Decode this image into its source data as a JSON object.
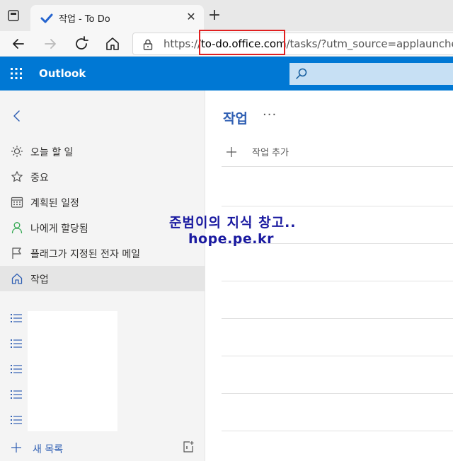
{
  "browser": {
    "tab_title": "작업 - To Do",
    "url_prefix": "https://",
    "url_domain": "to-do.office.com",
    "url_suffix": "/tasks/?utm_source=applauncher"
  },
  "app": {
    "name": "Outlook",
    "accent_color": "#0078d4"
  },
  "sidebar": {
    "items": [
      {
        "label": "오늘 할 일",
        "icon": "sun-icon"
      },
      {
        "label": "중요",
        "icon": "star-icon"
      },
      {
        "label": "계획된 일정",
        "icon": "calendar-icon"
      },
      {
        "label": "나에게 할당됨",
        "icon": "person-icon"
      },
      {
        "label": "플래그가 지정된 전자 메일",
        "icon": "flag-icon"
      },
      {
        "label": "작업",
        "icon": "home-icon",
        "active": true
      }
    ],
    "new_list_label": "새 목록"
  },
  "main": {
    "title": "작업",
    "more": "···",
    "add_task_label": "작업 추가"
  },
  "watermark": {
    "line1": "준범이의 지식 창고..",
    "line2": "hope.pe.kr"
  }
}
